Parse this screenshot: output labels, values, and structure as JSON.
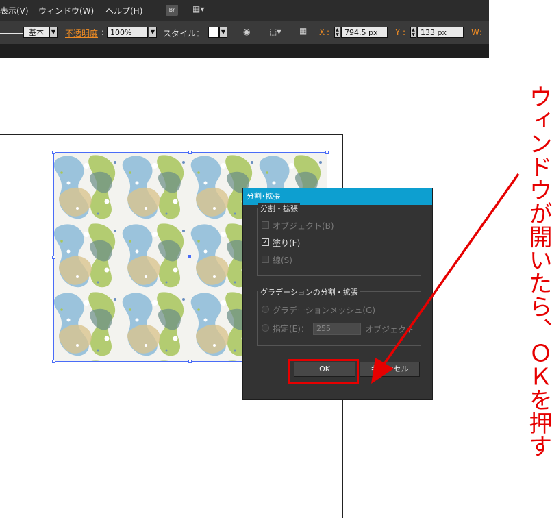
{
  "menubar": {
    "items": [
      "表示(V)",
      "ウィンドウ(W)",
      "ヘルプ(H)"
    ],
    "bridge_label": "Br"
  },
  "optionsbar": {
    "stroke_profile": "基本",
    "opacity_label": "不透明度",
    "opacity_value": "100%",
    "style_label": "スタイル：",
    "x_label": "X",
    "x_value": "794.5 px",
    "y_label": "Y",
    "y_value": "133 px",
    "w_label": "W"
  },
  "dialog": {
    "title": "分割･拡張",
    "group1_title": "分割・拡張",
    "object_label": "オブジェクト(B)",
    "fill_label": "塗り(F)",
    "stroke_label": "線(S)",
    "group2_title": "グラデーションの分割・拡張",
    "gradient_mesh_label": "グラデーションメッシュ(G)",
    "specify_label": "指定(E)：",
    "specify_value": "255",
    "object_unit": "オブジェクト",
    "ok_label": "OK",
    "cancel_label": "キャンセル",
    "object_checked": false,
    "fill_checked": true,
    "stroke_checked": false
  },
  "annotation": {
    "text": "ウィンドウが開いたら、ＯＫを押す",
    "color": "#e60000"
  },
  "colors": {
    "accent": "#0d9fd0",
    "highlight": "#f08c23",
    "selection": "#4a6cf7"
  }
}
